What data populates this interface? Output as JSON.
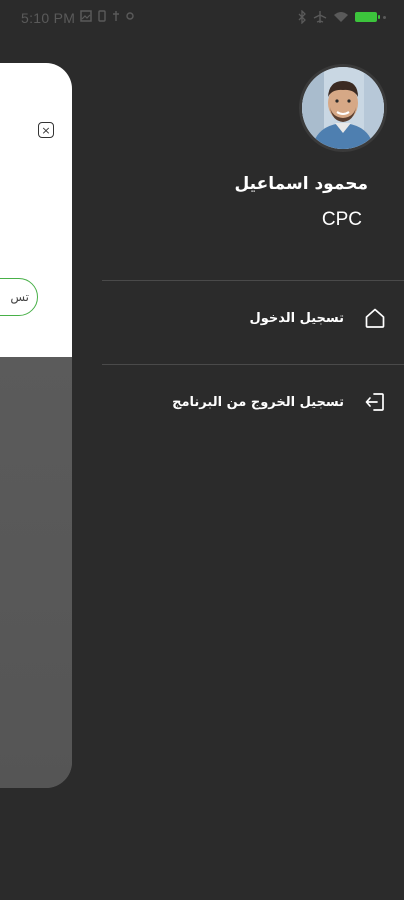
{
  "status_bar": {
    "time": "5:10 PM",
    "left_icons": [
      "image-icon",
      "notification-icon",
      "notification-icon",
      "notification-icon"
    ],
    "right_icons": [
      "bluetooth-icon",
      "airplane-icon",
      "wifi-icon",
      "battery-icon"
    ]
  },
  "background_screen": {
    "login_button_text": "تس"
  },
  "drawer": {
    "user": {
      "name": "محمود اسماعيل",
      "role": "CPC"
    },
    "menu": [
      {
        "label": "تسجيل الدخول",
        "icon": "home-icon"
      },
      {
        "label": "تسجيل الخروج من البرنامج",
        "icon": "logout-icon"
      }
    ]
  },
  "colors": {
    "drawer_bg": "#2b2b2b",
    "accent_green": "#48b048",
    "battery_green": "#3cc43c"
  }
}
